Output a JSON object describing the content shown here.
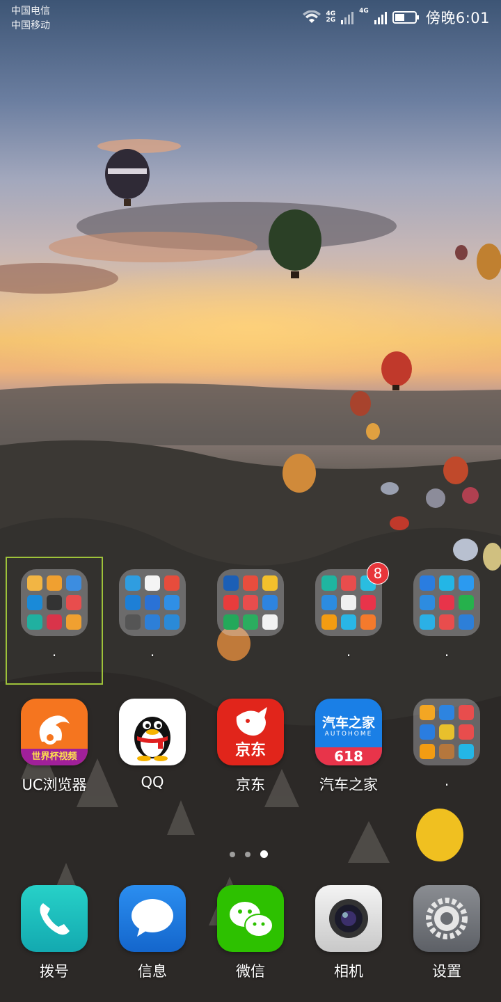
{
  "status_bar": {
    "carrier_1": "中国电信",
    "carrier_2": "中国移动",
    "net_1_top": "4G",
    "net_1_bottom": "2G",
    "net_2": "4G",
    "time": "傍晚6:01"
  },
  "folders": [
    {
      "label": ".",
      "colors": [
        "#f2b544",
        "#f0a030",
        "#3c8de0",
        "#1a8ad8",
        "#333",
        "#e84d4d",
        "#20b0a0",
        "#d9344a",
        "#f0a030"
      ]
    },
    {
      "label": ".",
      "colors": [
        "#2f9de0",
        "#f4f4f4",
        "#e74c3c",
        "#1d7fd6",
        "#2a72d6",
        "#2f8fe6",
        "#555",
        "#2d7fd8",
        "#2a8ad8"
      ]
    },
    {
      "label": "",
      "colors": [
        "#1c5fb6",
        "#e84d3d",
        "#f3c02c",
        "#e83c3c",
        "#e84d4d",
        "#2d84e0",
        "#23a85a",
        "#2bad5f",
        "#f2f2f2"
      ]
    },
    {
      "label": ".",
      "badge": "8",
      "colors": [
        "#1fb5a0",
        "#e84d4d",
        "#2abde0",
        "#2c8ce0",
        "#f0f0f0",
        "#e8344a",
        "#f39c12",
        "#29b6e6",
        "#f47a2c"
      ]
    },
    {
      "label": ".",
      "colors": [
        "#2a7de0",
        "#23b6e6",
        "#2b9af0",
        "#2d8ce0",
        "#e8344a",
        "#26b14c",
        "#2bb0e6",
        "#e84d4d",
        "#2d7fd8"
      ]
    }
  ],
  "apps_row": [
    {
      "label": "UC浏览器",
      "banner": "世界杯视频"
    },
    {
      "label": "QQ"
    },
    {
      "label": "京东",
      "icon_text": "京东"
    },
    {
      "label": "汽车之家",
      "icon_title": "汽车之家",
      "icon_sub": "AUTOHOME",
      "icon_num": "618"
    }
  ],
  "row_folder": {
    "label": ".",
    "colors": [
      "#f3a623",
      "#2d84e0",
      "#e84d4d",
      "#2a7de0",
      "#e8c02c",
      "#e84d4d",
      "#f39c12",
      "#b5773d",
      "#24b6e6"
    ]
  },
  "dock": [
    {
      "label": "拨号"
    },
    {
      "label": "信息"
    },
    {
      "label": "微信"
    },
    {
      "label": "相机"
    },
    {
      "label": "设置"
    }
  ]
}
